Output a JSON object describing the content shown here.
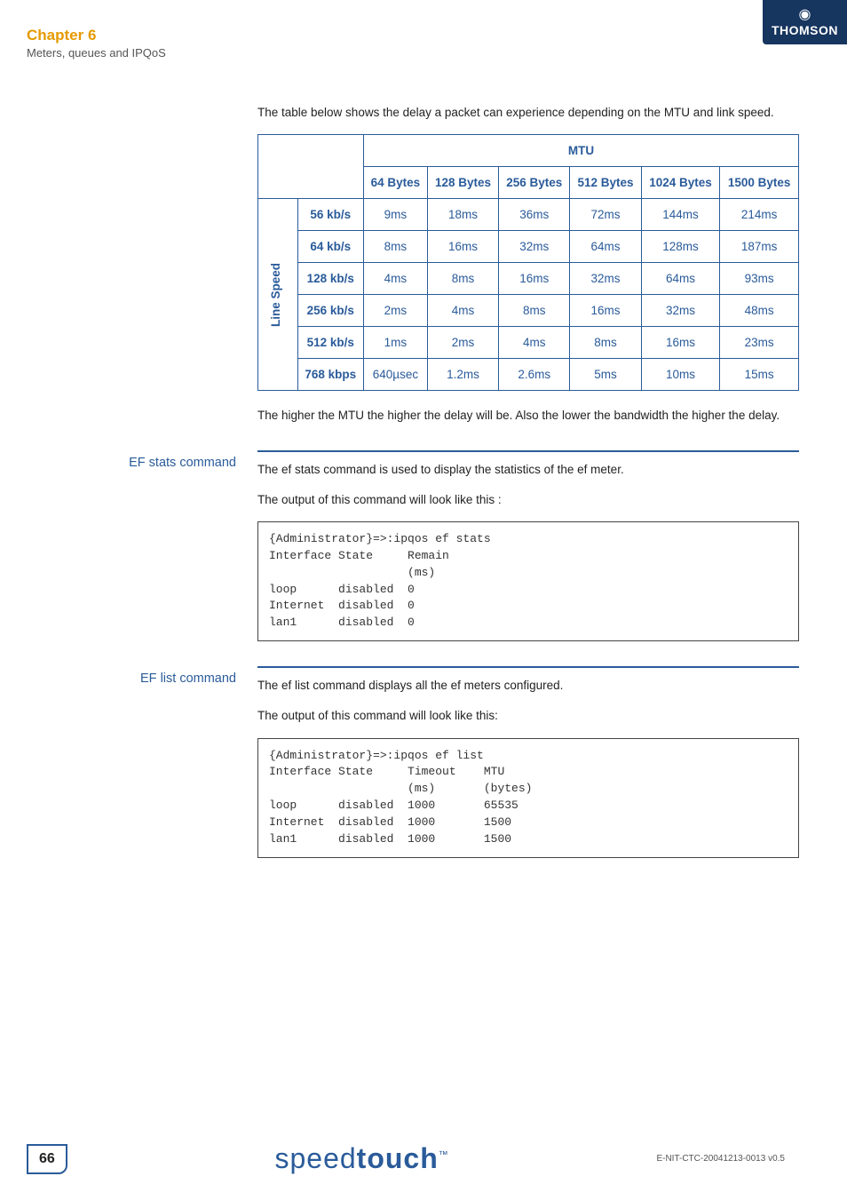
{
  "header": {
    "chapter": "Chapter 6",
    "subtitle": "Meters, queues and IPQoS",
    "logo_text": "THOMSON"
  },
  "intro": "The table below shows the delay a packet can experience depending on the MTU and link speed.",
  "table": {
    "col_header": "MTU",
    "row_header": "Line Speed",
    "cols": [
      "64 Bytes",
      "128 Bytes",
      "256 Bytes",
      "512 Bytes",
      "1024 Bytes",
      "1500 Bytes"
    ],
    "rows": [
      {
        "label": "56 kb/s",
        "cells": [
          "9ms",
          "18ms",
          "36ms",
          "72ms",
          "144ms",
          "214ms"
        ]
      },
      {
        "label": "64 kb/s",
        "cells": [
          "8ms",
          "16ms",
          "32ms",
          "64ms",
          "128ms",
          "187ms"
        ]
      },
      {
        "label": "128 kb/s",
        "cells": [
          "4ms",
          "8ms",
          "16ms",
          "32ms",
          "64ms",
          "93ms"
        ]
      },
      {
        "label": "256 kb/s",
        "cells": [
          "2ms",
          "4ms",
          "8ms",
          "16ms",
          "32ms",
          "48ms"
        ]
      },
      {
        "label": "512 kb/s",
        "cells": [
          "1ms",
          "2ms",
          "4ms",
          "8ms",
          "16ms",
          "23ms"
        ]
      },
      {
        "label": "768 kbps",
        "cells": [
          "640µsec",
          "1.2ms",
          "2.6ms",
          "5ms",
          "10ms",
          "15ms"
        ]
      }
    ]
  },
  "after_table": "The higher the MTU the higher the delay will be. Also the lower the bandwidth the higher the delay.",
  "sections": {
    "ef_stats": {
      "label": "EF stats command",
      "p1": "The ef stats command is used to display the statistics of the ef meter.",
      "p2": "The output of this command will look like this :",
      "code": "{Administrator}=>:ipqos ef stats\nInterface State     Remain\n                    (ms)\nloop      disabled  0\nInternet  disabled  0\nlan1      disabled  0"
    },
    "ef_list": {
      "label": "EF list command",
      "p1": "The ef list command displays all the ef meters configured.",
      "p2": "The output of this command will look like this:",
      "code": "{Administrator}=>:ipqos ef list\nInterface State     Timeout    MTU\n                    (ms)       (bytes)\nloop      disabled  1000       65535\nInternet  disabled  1000       1500\nlan1      disabled  1000       1500"
    }
  },
  "footer": {
    "page": "66",
    "brand_light": "speed",
    "brand_bold": "touch",
    "tm": "™",
    "docid": "E-NIT-CTC-20041213-0013 v0.5"
  }
}
